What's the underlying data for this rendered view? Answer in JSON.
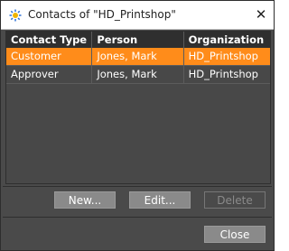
{
  "window": {
    "title": "Contacts of \"HD_Printshop\""
  },
  "table": {
    "columns": [
      "Contact Type",
      "Person",
      "Organization"
    ],
    "rows": [
      {
        "cells": [
          "Customer",
          "Jones, Mark",
          "HD_Printshop"
        ],
        "selected": true
      },
      {
        "cells": [
          "Approver",
          "Jones, Mark",
          "HD_Printshop"
        ],
        "selected": false
      }
    ]
  },
  "buttons": {
    "new": "New...",
    "edit": "Edit...",
    "delete": "Delete",
    "close": "Close"
  },
  "colors": {
    "selection": "#ff8c1a",
    "background": "#4a4a4a"
  }
}
